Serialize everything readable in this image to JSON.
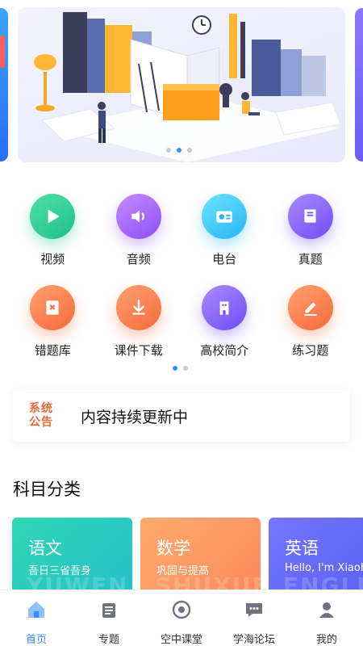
{
  "banner": {
    "slides": 3,
    "active_slide": 2
  },
  "colors": {
    "accent": "#3b8dff",
    "notice": "#e86a36"
  },
  "grid": {
    "items": [
      {
        "label": "视频",
        "icon": "play-icon",
        "color": "green"
      },
      {
        "label": "音频",
        "icon": "speaker-icon",
        "color": "purple"
      },
      {
        "label": "电台",
        "icon": "radio-icon",
        "color": "cyan"
      },
      {
        "label": "真题",
        "icon": "book-icon",
        "color": "violet"
      },
      {
        "label": "错题库",
        "icon": "wrong-book-icon",
        "color": "orange"
      },
      {
        "label": "课件下载",
        "icon": "download-icon",
        "color": "orange"
      },
      {
        "label": "高校简介",
        "icon": "building-icon",
        "color": "violet"
      },
      {
        "label": "练习题",
        "icon": "pencil-icon",
        "color": "orange"
      }
    ],
    "pages": 2,
    "active_page": 1
  },
  "notice": {
    "badge_line1": "系统",
    "badge_line2": "公告",
    "text": "内容持续更新中"
  },
  "subjects": {
    "title": "科目分类",
    "cards": [
      {
        "title": "语文",
        "subtitle": "吾日三省吾身",
        "watermark": "YUWEN"
      },
      {
        "title": "数学",
        "subtitle": "巩固与提高",
        "watermark": "SHUXUE"
      },
      {
        "title": "英语",
        "subtitle": "Hello, I'm Xiaohong",
        "watermark": "ENGLISH"
      }
    ]
  },
  "tabbar": {
    "items": [
      {
        "label": "首页",
        "icon": "home-icon",
        "active": true
      },
      {
        "label": "专题",
        "icon": "topics-icon",
        "active": false
      },
      {
        "label": "空中课堂",
        "icon": "disc-icon",
        "active": false
      },
      {
        "label": "学海论坛",
        "icon": "chat-icon",
        "active": false
      },
      {
        "label": "我的",
        "icon": "user-icon",
        "active": false
      }
    ]
  }
}
